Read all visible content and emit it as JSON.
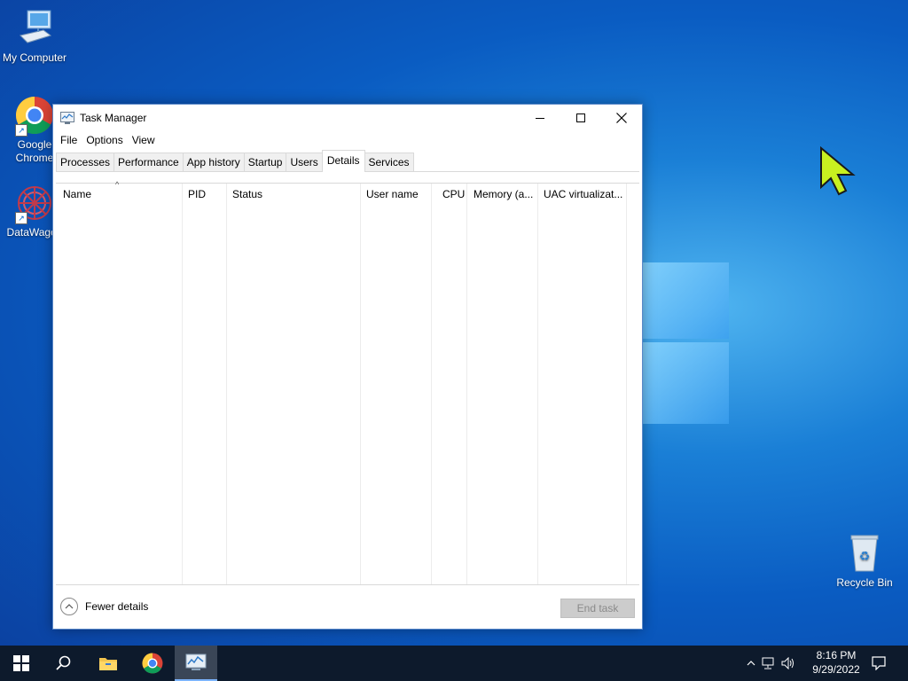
{
  "desktop": {
    "icons": [
      {
        "label": "My Computer"
      },
      {
        "label": "Google Chrome"
      },
      {
        "label": "DataWagon"
      },
      {
        "label": "Recycle Bin"
      }
    ]
  },
  "window": {
    "title": "Task Manager",
    "menu": [
      "File",
      "Options",
      "View"
    ],
    "tabs": [
      "Processes",
      "Performance",
      "App history",
      "Startup",
      "Users",
      "Details",
      "Services"
    ],
    "active_tab": "Details",
    "columns": [
      "Name",
      "PID",
      "Status",
      "User name",
      "CPU",
      "Memory (a...",
      "UAC virtualizat..."
    ],
    "sorted_column": "Name",
    "rows": [],
    "footer": {
      "fewer_details": "Fewer details",
      "end_task": "End task"
    }
  },
  "taskbar": {
    "items": [
      "start-icon",
      "search-icon",
      "file-explorer-icon",
      "chrome-icon",
      "task-manager-icon"
    ],
    "active_item": "task-manager-icon",
    "clock": {
      "time": "8:16 PM",
      "date": "9/29/2022"
    }
  },
  "colors": {
    "desktop_blue": "#0a5cc2",
    "taskbar": "#0d1a2c",
    "window_border": "#5a88c8"
  }
}
